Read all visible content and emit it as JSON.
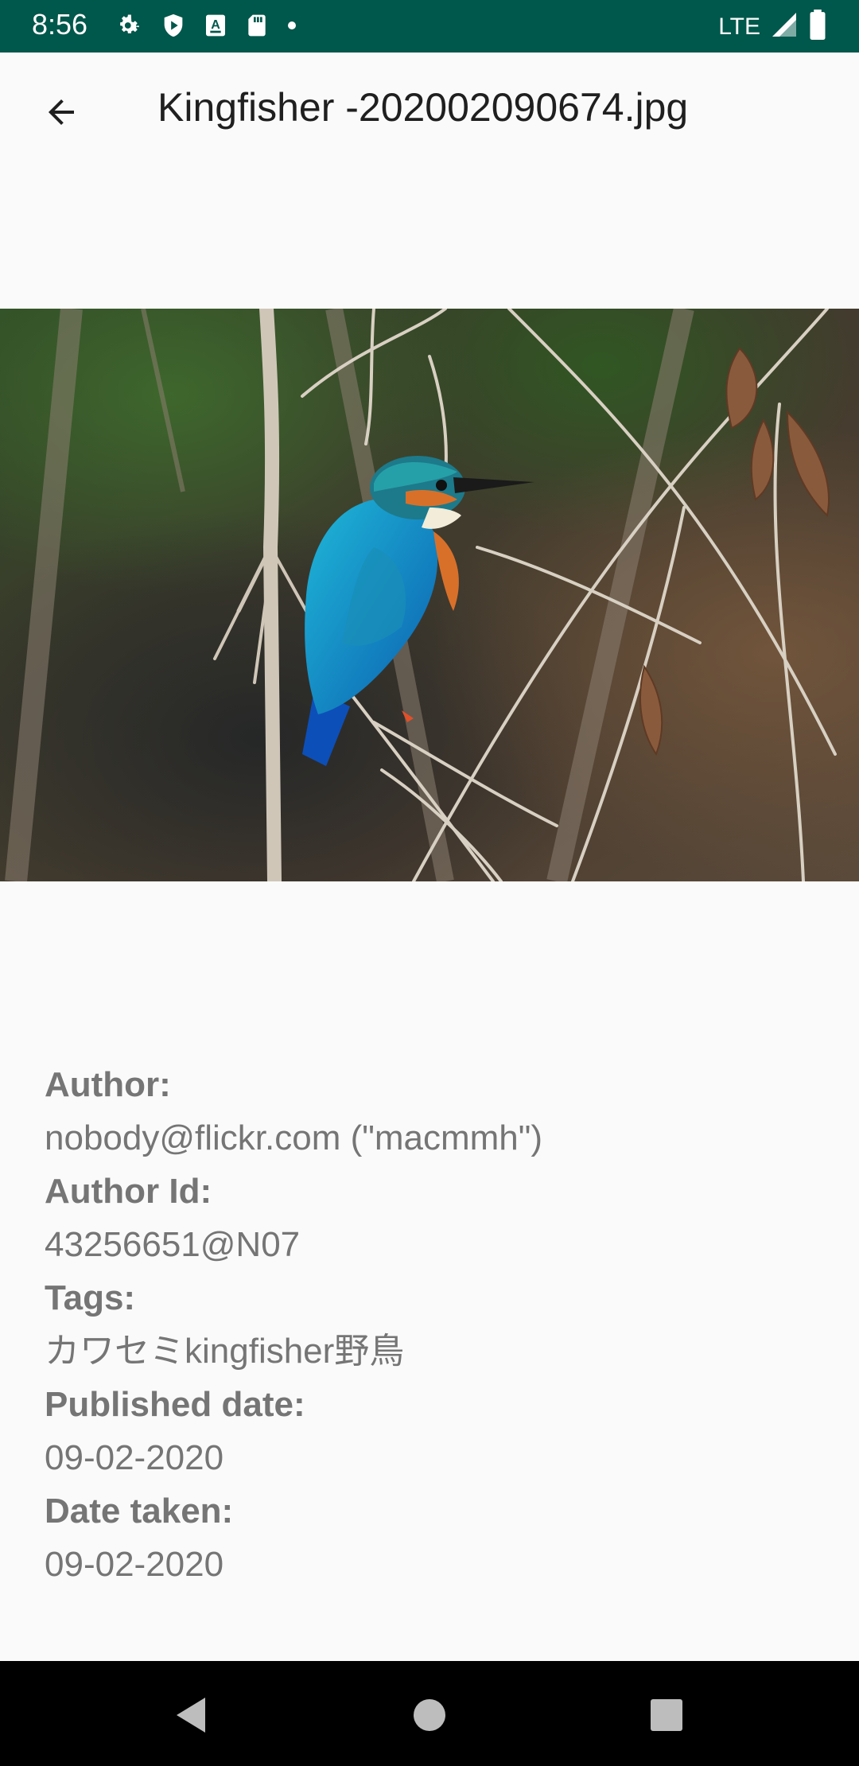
{
  "status_bar": {
    "time": "8:56",
    "network": "LTE",
    "icons": [
      "gear-icon",
      "play-protect-icon",
      "keyboard-a-icon",
      "sd-card-icon",
      "dot-icon",
      "signal-icon",
      "battery-icon"
    ]
  },
  "app_bar": {
    "title": "Kingfisher -202002090674.jpg",
    "back_icon": "arrow-back-icon"
  },
  "photo": {
    "subject": "kingfisher"
  },
  "details": [
    {
      "label": "Author:",
      "value": "nobody@flickr.com (\"macmmh\")"
    },
    {
      "label": "Author Id:",
      "value": "43256651@N07"
    },
    {
      "label": "Tags:",
      "value": "カワセミkingfisher野鳥"
    },
    {
      "label": "Published date:",
      "value": "09-02-2020"
    },
    {
      "label": "Date taken:",
      "value": "09-02-2020"
    }
  ],
  "nav_bar": {
    "icons": [
      "back-triangle-icon",
      "home-circle-icon",
      "recents-square-icon"
    ]
  },
  "colors": {
    "status_bar": "#00574b",
    "background": "#fafafa",
    "text_secondary": "#757575"
  }
}
